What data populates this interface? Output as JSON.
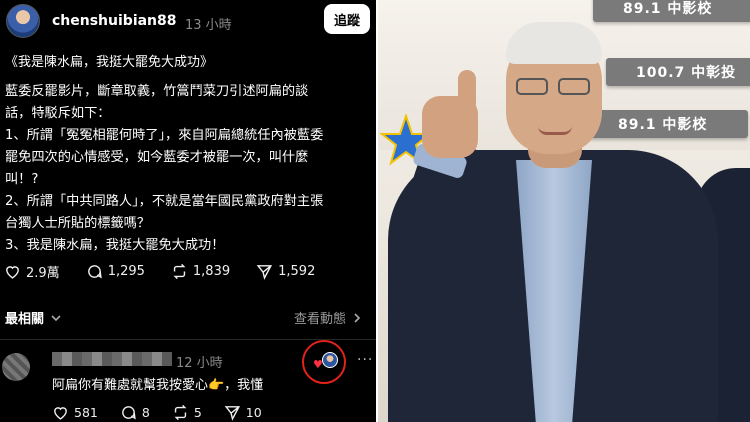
{
  "post": {
    "username": "chenshuibian88",
    "time": "13 小時",
    "follow_label": "追蹤",
    "title": "《我是陳水扁，我挺大罷免大成功》",
    "body_lines": [
      "藍委反罷影片，斷章取義，竹篙鬥菜刀引述阿扁的談",
      "話，特駁斥如下：",
      "1、所謂「冤冤相罷何時了」，來自阿扁總統任內被藍委",
      "罷免四次的心情感受，如今藍委才被罷一次，叫什麼",
      "叫！?",
      "2、所謂「中共同路人」，不就是當年國民黨政府對主張",
      "台獨人士所貼的標籤嗎？",
      "3、我是陳水扁，我挺大罷免大成功！"
    ],
    "stats": {
      "likes": "2.9萬",
      "comments": "1,295",
      "reposts": "1,839",
      "shares": "1,592"
    }
  },
  "replies_bar": {
    "sort_label": "最相關",
    "activity_label": "查看動態"
  },
  "comment": {
    "time": "12 小時",
    "text": "阿扁你有難處就幫我按愛心👉，我懂",
    "stats": {
      "likes": "581",
      "comments": "8",
      "reposts": "5",
      "shares": "10"
    },
    "more": "···"
  },
  "photo": {
    "signs": [
      "89.1 中影校",
      "100.7 中彰投",
      "89.1 中影校"
    ]
  },
  "colors": {
    "accent_red": "#e2231a",
    "heart": "#ff3040",
    "background": "#000000"
  }
}
